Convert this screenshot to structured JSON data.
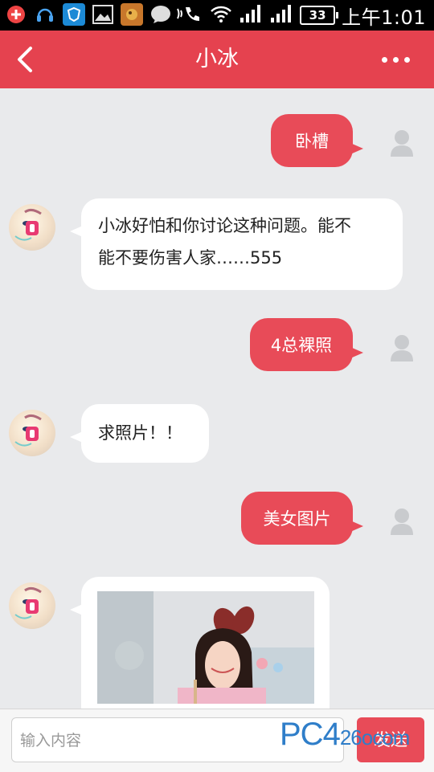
{
  "status_bar": {
    "battery": "33",
    "time": "上午1:01"
  },
  "header": {
    "title": "小冰"
  },
  "messages": [
    {
      "sender": "user",
      "text": "卧槽"
    },
    {
      "sender": "bot",
      "lines": [
        "小冰好怕和你讨论这种问题。能不",
        "能不要伤害人家……555"
      ]
    },
    {
      "sender": "user",
      "text": "4总裸照"
    },
    {
      "sender": "bot",
      "lines": [
        "求照片！！"
      ]
    },
    {
      "sender": "user",
      "text": "美女图片"
    },
    {
      "sender": "bot",
      "type": "image"
    }
  ],
  "input_bar": {
    "placeholder": "输入内容",
    "send_label": "发送"
  },
  "watermark": {
    "brand": "PC4",
    "suffix": "26ocom"
  },
  "colors": {
    "accent": "#e5424f",
    "bubble_out": "#e84b58",
    "background": "#e9eaec"
  }
}
